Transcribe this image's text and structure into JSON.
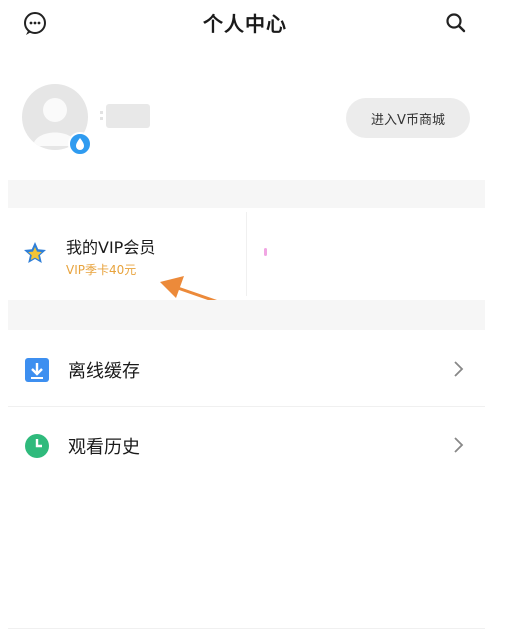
{
  "header": {
    "title": "个人中心",
    "message_icon": "message-icon",
    "search_icon": "search-icon"
  },
  "profile": {
    "avatar_icon": "avatar-placeholder-icon",
    "shop_button_label": "进入V币商城"
  },
  "vip": {
    "icon": "star-icon",
    "title": "我的VIP会员",
    "subtitle": "VIP季卡40元",
    "subtitle_color": "#e8a33d",
    "annotation_color": "#ec8a3a"
  },
  "menu": {
    "items": [
      {
        "label": "离线缓存",
        "icon": "download-icon",
        "color": "#3d8ff0"
      },
      {
        "label": "观看历史",
        "icon": "clock-icon",
        "color": "#2fba7c"
      }
    ]
  }
}
